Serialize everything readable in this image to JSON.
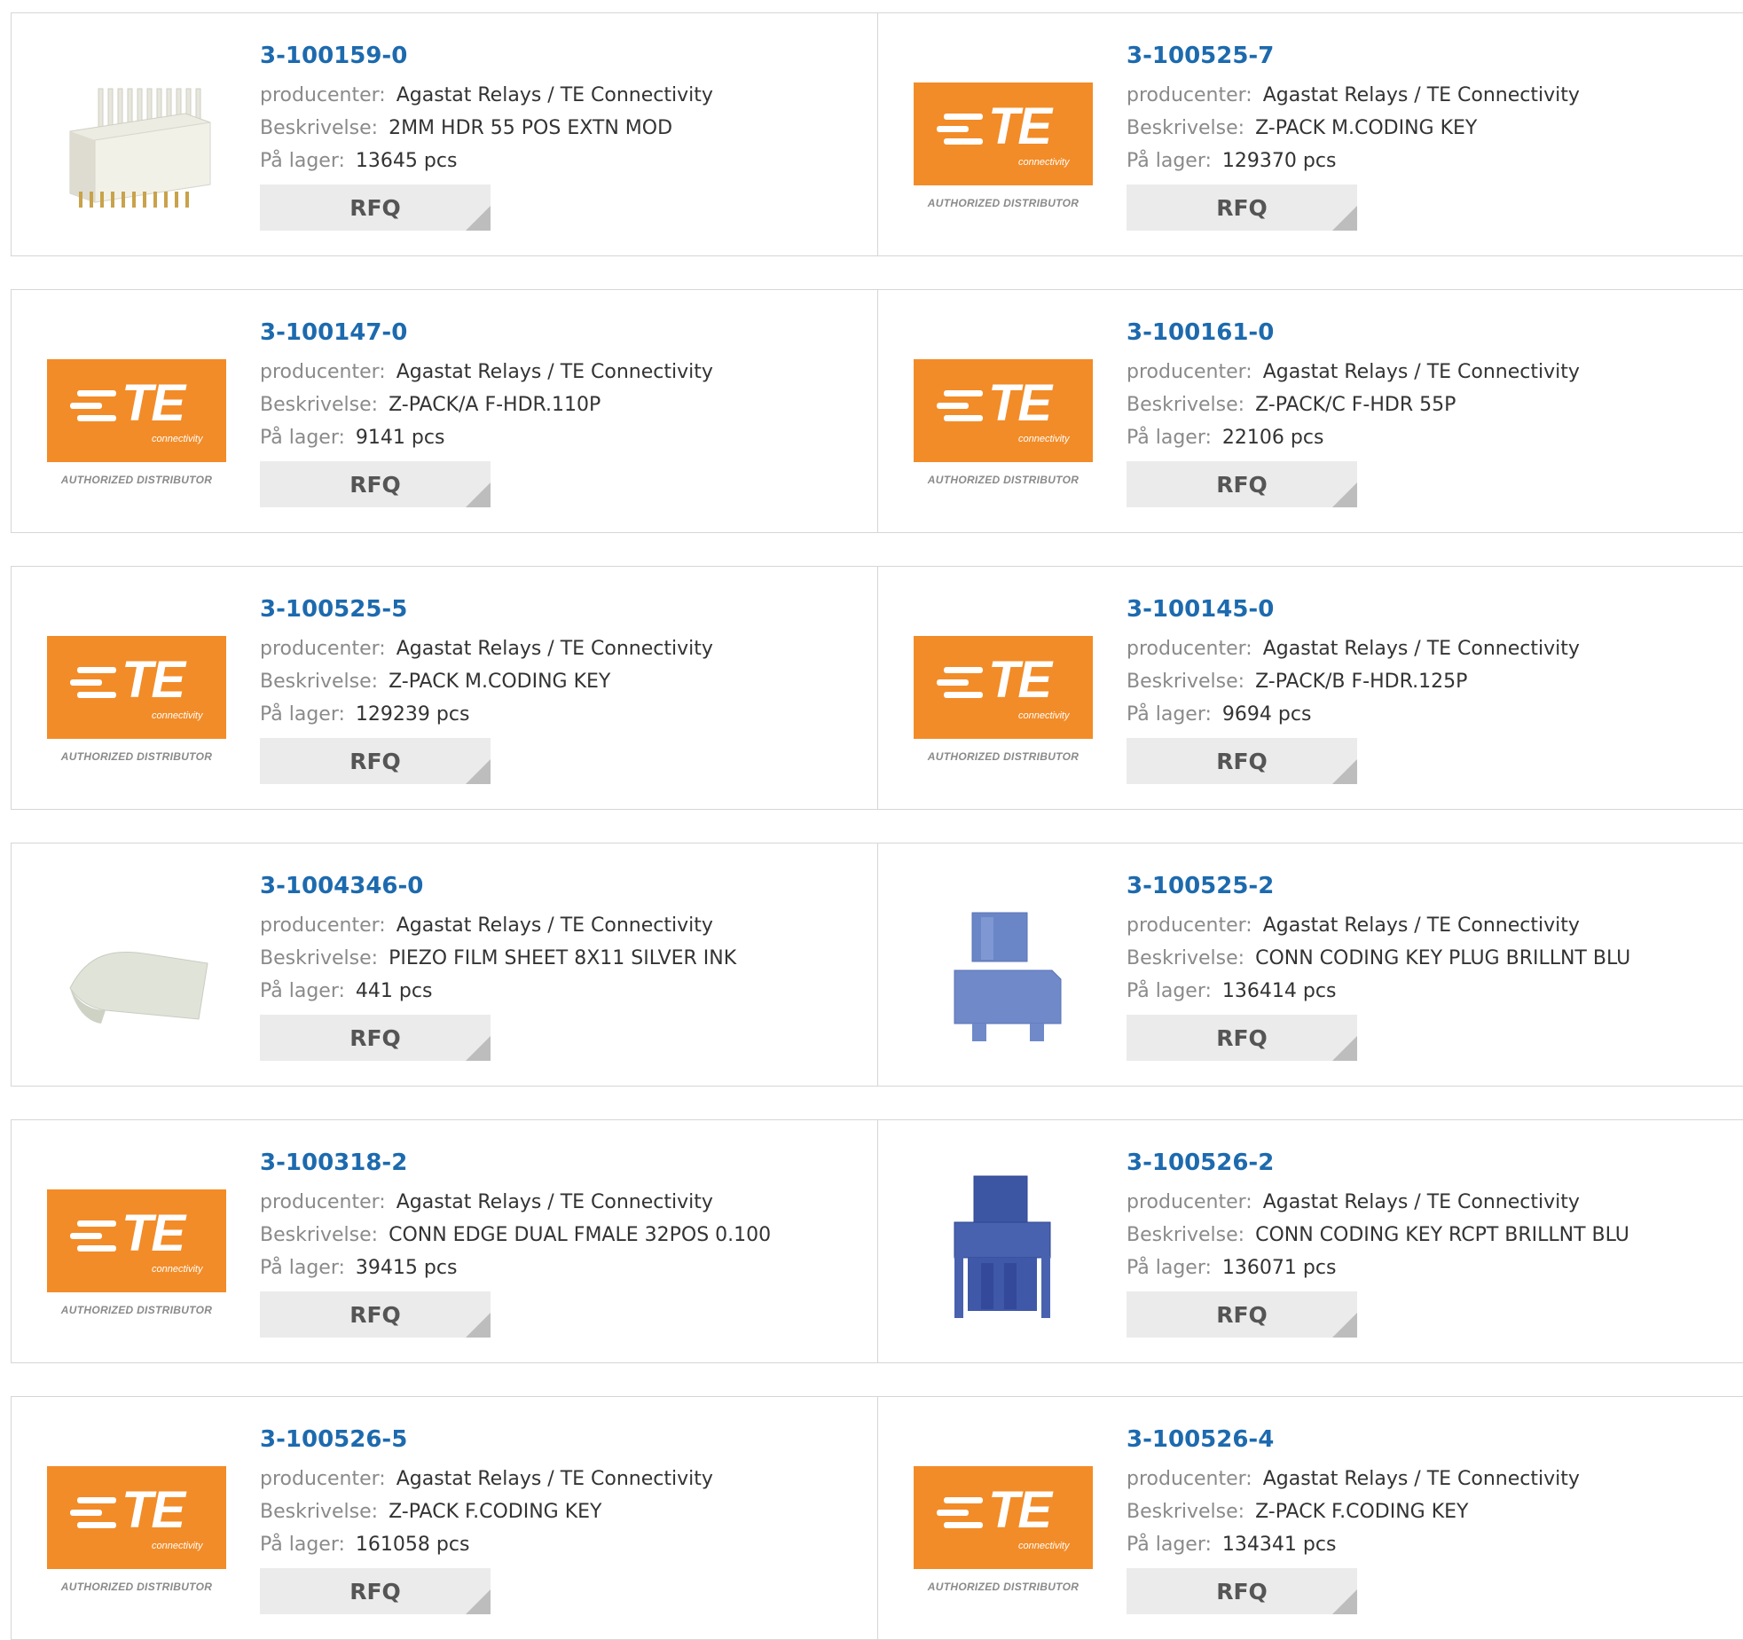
{
  "labels": {
    "manufacturer": "producenter:",
    "description": "Beskrivelse:",
    "stock": "På lager:",
    "rfq": "RFQ",
    "logo_word": "TE",
    "logo_sub": "connectivity",
    "logo_authorized": "AUTHORIZED DISTRIBUTOR"
  },
  "colors": {
    "part_number": "#1d6aae",
    "logo_orange": "#f28c28",
    "rfq_bg": "#ebebeb"
  },
  "products": [
    {
      "part": "3-100159-0",
      "manufacturer": "Agastat Relays / TE Connectivity",
      "description": "2MM HDR 55 POS EXTN MOD",
      "stock": "13645 pcs",
      "image": "header-connector-photo"
    },
    {
      "part": "3-100525-7",
      "manufacturer": "Agastat Relays / TE Connectivity",
      "description": "Z-PACK M.CODING KEY",
      "stock": "129370 pcs",
      "image": "te-logo"
    },
    {
      "part": "3-100147-0",
      "manufacturer": "Agastat Relays / TE Connectivity",
      "description": "Z-PACK/A F-HDR.110P",
      "stock": "9141 pcs",
      "image": "te-logo"
    },
    {
      "part": "3-100161-0",
      "manufacturer": "Agastat Relays / TE Connectivity",
      "description": "Z-PACK/C F-HDR 55P",
      "stock": "22106 pcs",
      "image": "te-logo"
    },
    {
      "part": "3-100525-5",
      "manufacturer": "Agastat Relays / TE Connectivity",
      "description": "Z-PACK M.CODING KEY",
      "stock": "129239 pcs",
      "image": "te-logo"
    },
    {
      "part": "3-100145-0",
      "manufacturer": "Agastat Relays / TE Connectivity",
      "description": "Z-PACK/B F-HDR.125P",
      "stock": "9694 pcs",
      "image": "te-logo"
    },
    {
      "part": "3-1004346-0",
      "manufacturer": "Agastat Relays / TE Connectivity",
      "description": "PIEZO FILM SHEET 8X11 SILVER INK",
      "stock": "441 pcs",
      "image": "film-sheet-photo"
    },
    {
      "part": "3-100525-2",
      "manufacturer": "Agastat Relays / TE Connectivity",
      "description": "CONN CODING KEY PLUG BRILLNT BLU",
      "stock": "136414 pcs",
      "image": "coding-key-plug-photo"
    },
    {
      "part": "3-100318-2",
      "manufacturer": "Agastat Relays / TE Connectivity",
      "description": "CONN EDGE DUAL FMALE 32POS 0.100",
      "stock": "39415 pcs",
      "image": "te-logo"
    },
    {
      "part": "3-100526-2",
      "manufacturer": "Agastat Relays / TE Connectivity",
      "description": "CONN CODING KEY RCPT BRILLNT BLU",
      "stock": "136071 pcs",
      "image": "coding-key-rcpt-photo"
    },
    {
      "part": "3-100526-5",
      "manufacturer": "Agastat Relays / TE Connectivity",
      "description": "Z-PACK F.CODING KEY",
      "stock": "161058 pcs",
      "image": "te-logo"
    },
    {
      "part": "3-100526-4",
      "manufacturer": "Agastat Relays / TE Connectivity",
      "description": "Z-PACK F.CODING KEY",
      "stock": "134341 pcs",
      "image": "te-logo"
    }
  ]
}
